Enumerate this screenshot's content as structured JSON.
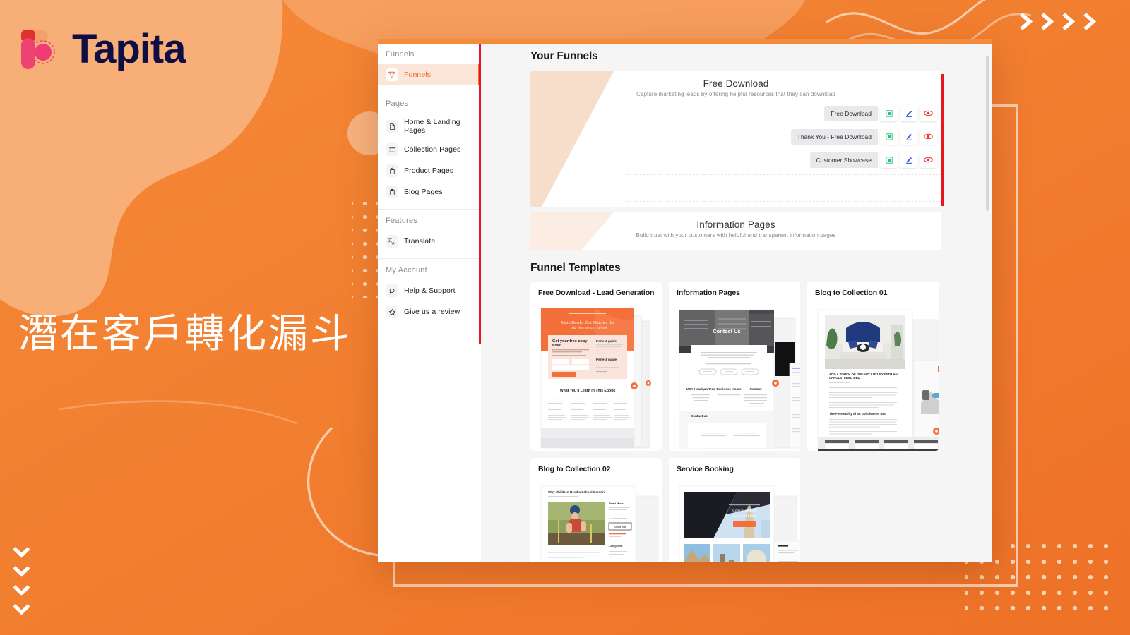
{
  "brand": {
    "name": "Tapita",
    "logo_icon": "tapita-logo-icon",
    "name_color": "#0F0E44",
    "accent": "#F0862E"
  },
  "headline": {
    "text": "潛在客戶轉化漏斗",
    "color": "#FFFFFF"
  },
  "decor": {
    "chevron_right_icon": "chevron-right-icon",
    "chevron_down_icon": "chevron-down-icon",
    "chevron_right_count": 4,
    "chevron_down_count": 4,
    "dot_pattern_icon": "dot-grid-pattern"
  },
  "app": {
    "topbar_color": "#F68B3C",
    "sidebar": {
      "sections": [
        {
          "heading": "Funnels",
          "items": [
            {
              "label": "Funnels",
              "icon": "funnel-icon",
              "active": true
            }
          ]
        },
        {
          "heading": "Pages",
          "items": [
            {
              "label": "Home & Landing Pages",
              "icon": "document-icon",
              "active": false
            },
            {
              "label": "Collection Pages",
              "icon": "list-icon",
              "active": false
            },
            {
              "label": "Product Pages",
              "icon": "shopping-bag-icon",
              "active": false
            },
            {
              "label": "Blog Pages",
              "icon": "clipboard-icon",
              "active": false
            }
          ]
        },
        {
          "heading": "Features",
          "items": [
            {
              "label": "Translate",
              "icon": "translate-icon",
              "active": false
            }
          ]
        },
        {
          "heading": "My Account",
          "items": [
            {
              "label": "Help & Support",
              "icon": "chat-bubble-icon",
              "active": false
            },
            {
              "label": "Give us a review",
              "icon": "star-icon",
              "active": false
            }
          ]
        }
      ]
    },
    "main": {
      "your_funnels_title": "Your Funnels",
      "funnel_templates_title": "Funnel Templates",
      "funnels": [
        {
          "name": "Free Download",
          "description": "Capture marketing leads by offering helpful resources that they can download",
          "pages": [
            {
              "label": "Free Download"
            },
            {
              "label": "Thank You - Free Download"
            },
            {
              "label": "Customer Showcase"
            }
          ],
          "actions": [
            {
              "name": "duplicate-icon",
              "color": "#2EBD7A"
            },
            {
              "name": "edit-pen-icon",
              "color": "#3A55D9"
            },
            {
              "name": "preview-eye-icon",
              "color": "#EB2B2B"
            }
          ]
        },
        {
          "name": "Information Pages",
          "description": "Build trust with your customers with helpful and transparent information pages",
          "pages": [],
          "actions": []
        }
      ],
      "templates": [
        {
          "title": "Free Download - Lead Generation",
          "thumb": "lead-generation-thumb"
        },
        {
          "title": "Information Pages",
          "thumb": "information-pages-thumb"
        },
        {
          "title": "Blog to Collection 01",
          "thumb": "blog-collection-01-thumb"
        },
        {
          "title": "Blog to Collection 02",
          "thumb": "blog-collection-02-thumb"
        },
        {
          "title": "Service Booking",
          "thumb": "service-booking-thumb"
        }
      ],
      "thumb_text": {
        "lead_hero_line1": "Main Header that Matches the",
        "lead_hero_line2": "Link that Was Clicked",
        "lead_form_title": "Get your free copy now!",
        "lead_section": "What You'll Learn in This Ebook",
        "lead_guide": "Perfect guide",
        "info_hero": "Contact Us",
        "info_col1": "USA Headquarters",
        "info_col2": "Business Hours",
        "info_col3": "Contact",
        "info_footer": "Contact us",
        "blog01_heading": "ADD A TOUCH OF DREAMY LUXURY WITH AN UPHOLSTERED BED",
        "blog01_sub": "The Personality of an Upholstered Bed",
        "blog02_heading": "Why Children Need a School Garden",
        "service_hero_line1": "Consult With A",
        "service_hero_line2": "Peace Of Mind"
      }
    }
  }
}
